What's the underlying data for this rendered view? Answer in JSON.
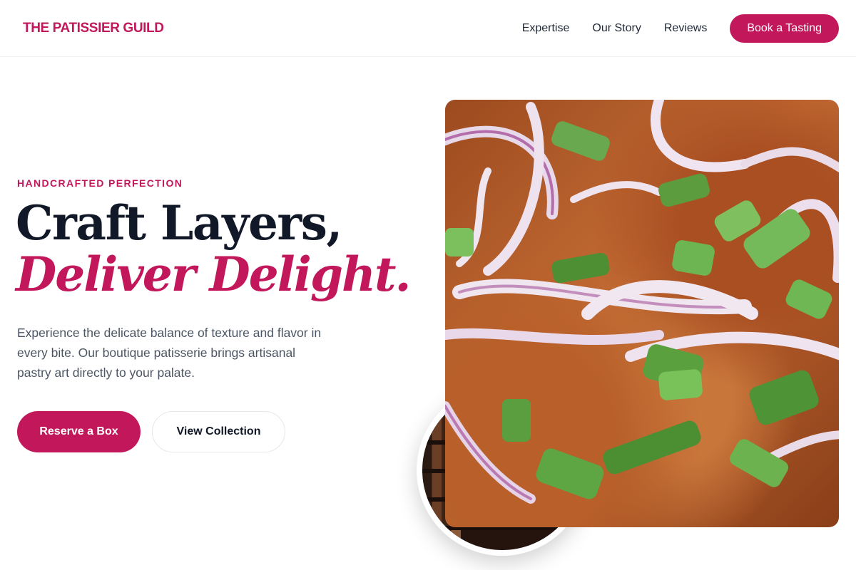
{
  "header": {
    "brand": "THE PATISSIER GUILD",
    "nav": [
      "Expertise",
      "Our Story",
      "Reviews"
    ],
    "cta_label": "Book a Tasting"
  },
  "hero": {
    "eyebrow": "HANDCRAFTED PERFECTION",
    "headline_line1": "Craft Layers,",
    "headline_line2": "Deliver Delight.",
    "description": "Experience the delicate balance of texture and flavor in every bite. Our boutique patisserie brings artisanal pastry art directly to your palate.",
    "primary_button": "Reserve a Box",
    "secondary_button": "View Collection"
  },
  "images": {
    "main_photo": "food-closeup-onions-scallions",
    "inset_photo": "shop-shelves"
  },
  "colors": {
    "accent": "#c2185b",
    "heading": "#111827",
    "body": "#4b5563",
    "background": "#ffffff"
  }
}
